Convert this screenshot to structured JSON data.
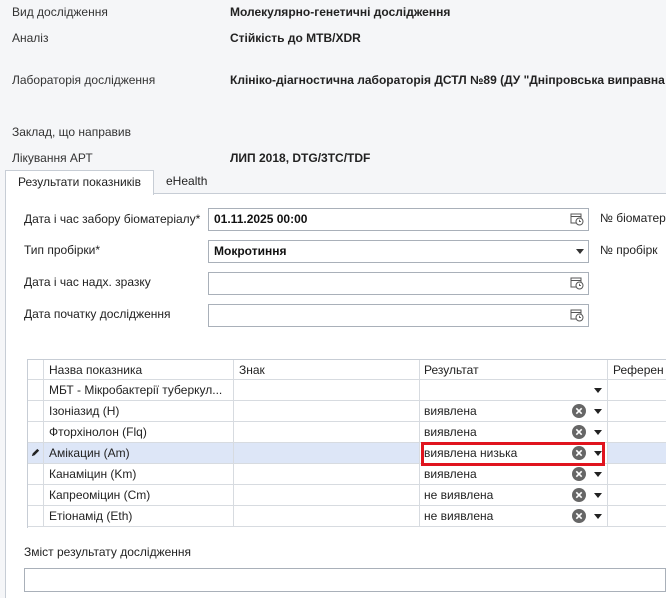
{
  "info": [
    {
      "label": "Вид дослідження",
      "value": "Молекулярно-генетичні дослідження"
    },
    {
      "label": "Аналіз",
      "value": "Стійкість до МТВ/XDR"
    },
    {
      "label": "Лабораторія дослідження",
      "value": "Клініко-діагностична лабораторія ДСТЛ №89 (ДУ \"Дніпровська виправна"
    },
    {
      "label": "Заклад, що направив",
      "value": ""
    },
    {
      "label": "Лікування АРТ",
      "value": "ЛИП 2018, DTG/3TC/TDF"
    }
  ],
  "tabs": [
    {
      "label": "Результати показників",
      "active": true
    },
    {
      "label": "eHealth",
      "active": false
    }
  ],
  "form": {
    "collection_datetime": {
      "label": "Дата і час забору біоматеріалу*",
      "value": "01.11.2025 00:00",
      "icon": "calendar-clock-icon"
    },
    "tube_type": {
      "label": "Тип пробірки*",
      "value": "Мокротиння",
      "icon": "chevron-down-icon"
    },
    "received_datetime": {
      "label": "Дата і час надх. зразку",
      "value": "",
      "icon": "calendar-clock-icon"
    },
    "start_date": {
      "label": "Дата початку дослідження",
      "value": "",
      "icon": "calendar-clock-icon"
    },
    "right_labels": [
      "№ біоматер",
      "№ пробірк"
    ]
  },
  "grid": {
    "columns": [
      "Назва показника",
      "Знак",
      "Результат",
      "Референ"
    ],
    "rows": [
      {
        "name": "МБТ - Мікробактерії туберкул...",
        "sign": "",
        "result": "",
        "clear": false,
        "selected": false
      },
      {
        "name": "Ізоніазид (H)",
        "sign": "",
        "result": "виявлена",
        "clear": true,
        "selected": false
      },
      {
        "name": "Фторхінолон (Flq)",
        "sign": "",
        "result": "виявлена",
        "clear": true,
        "selected": false
      },
      {
        "name": "Амікацин (Am)",
        "sign": "",
        "result": "виявлена низька",
        "clear": true,
        "selected": true
      },
      {
        "name": "Канаміцин (Km)",
        "sign": "",
        "result": "виявлена",
        "clear": true,
        "selected": false
      },
      {
        "name": "Капреоміцин (Cm)",
        "sign": "",
        "result": "не виявлена",
        "clear": true,
        "selected": false
      },
      {
        "name": "Етіонамід (Eth)",
        "sign": "",
        "result": "не виявлена",
        "clear": true,
        "selected": false
      }
    ]
  },
  "content_result": {
    "label": "Зміст результату дослідження",
    "value": ""
  },
  "colors": {
    "highlight": "#e0141e",
    "selected_row": "#dde6f7"
  }
}
